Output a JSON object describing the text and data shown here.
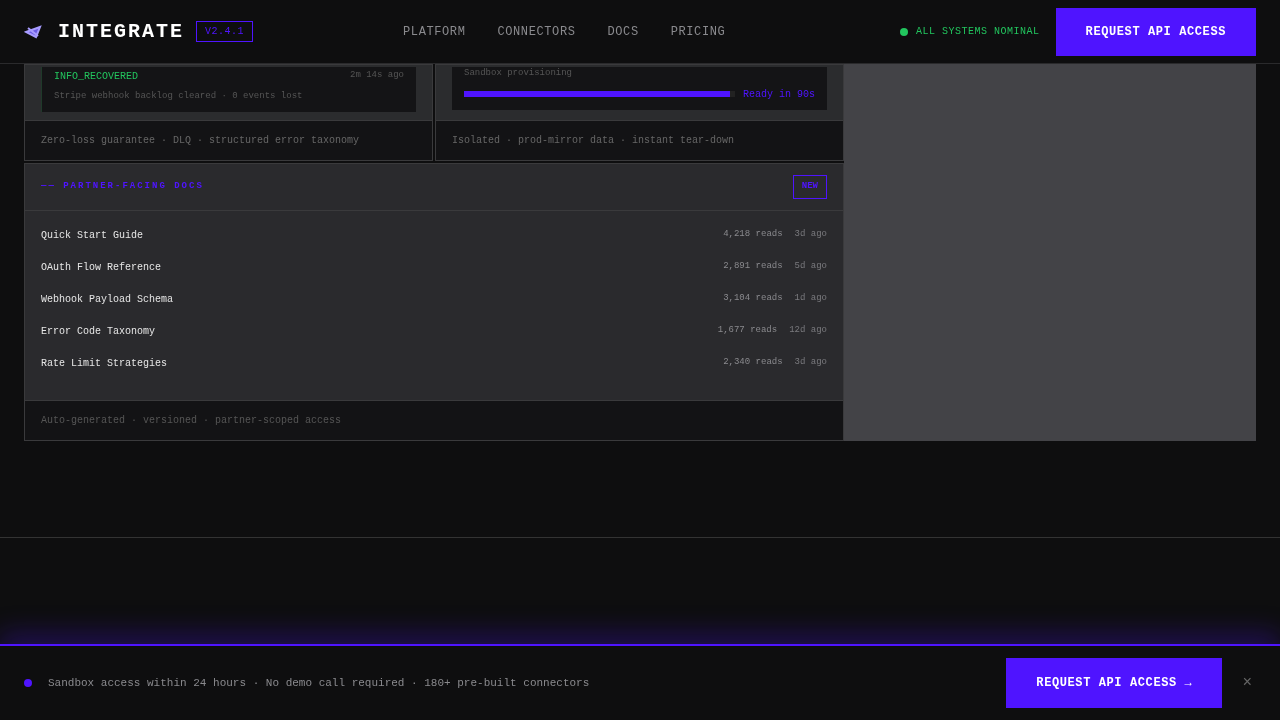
{
  "header": {
    "brand": "INTEGRATE",
    "version": "V2.4.1",
    "nav": [
      {
        "label": "PLATFORM"
      },
      {
        "label": "CONNECTORS"
      },
      {
        "label": "DOCS"
      },
      {
        "label": "PRICING"
      }
    ],
    "status": {
      "label": "ALL SYSTEMS NOMINAL",
      "color": "#22c55e"
    },
    "cta": "REQUEST API ACCESS"
  },
  "cards": [
    {
      "kind": "log",
      "code": "INFO_RECOVERED",
      "time": "2m 14s ago",
      "detail": "Stripe webhook backlog cleared · 0 events lost",
      "footer": "Zero-loss guarantee · DLQ · structured error taxonomy"
    },
    {
      "kind": "progress",
      "label": "Sandbox provisioning",
      "level": 0.98,
      "reading": "Ready in 90s",
      "footer": "Isolated · prod-mirror data · instant tear-down"
    }
  ],
  "docs": {
    "title": "—— PARTNER-FACING DOCS",
    "badge": "NEW",
    "items": [
      {
        "title": "Quick Start Guide",
        "reads": "4,218 reads",
        "age": "3d ago"
      },
      {
        "title": "OAuth Flow Reference",
        "reads": "2,891 reads",
        "age": "5d ago"
      },
      {
        "title": "Webhook Payload Schema",
        "reads": "3,104 reads",
        "age": "1d ago"
      },
      {
        "title": "Error Code Taxonomy",
        "reads": "1,677 reads",
        "age": "12d ago"
      },
      {
        "title": "Rate Limit Strategies",
        "reads": "2,340 reads",
        "age": "3d ago"
      }
    ],
    "footer": "Auto-generated · versioned · partner-scoped access"
  },
  "banner": {
    "text": "Sandbox access within 24 hours · No demo call required · 180+ pre-built connectors",
    "cta": "REQUEST API ACCESS →",
    "close": "×"
  }
}
